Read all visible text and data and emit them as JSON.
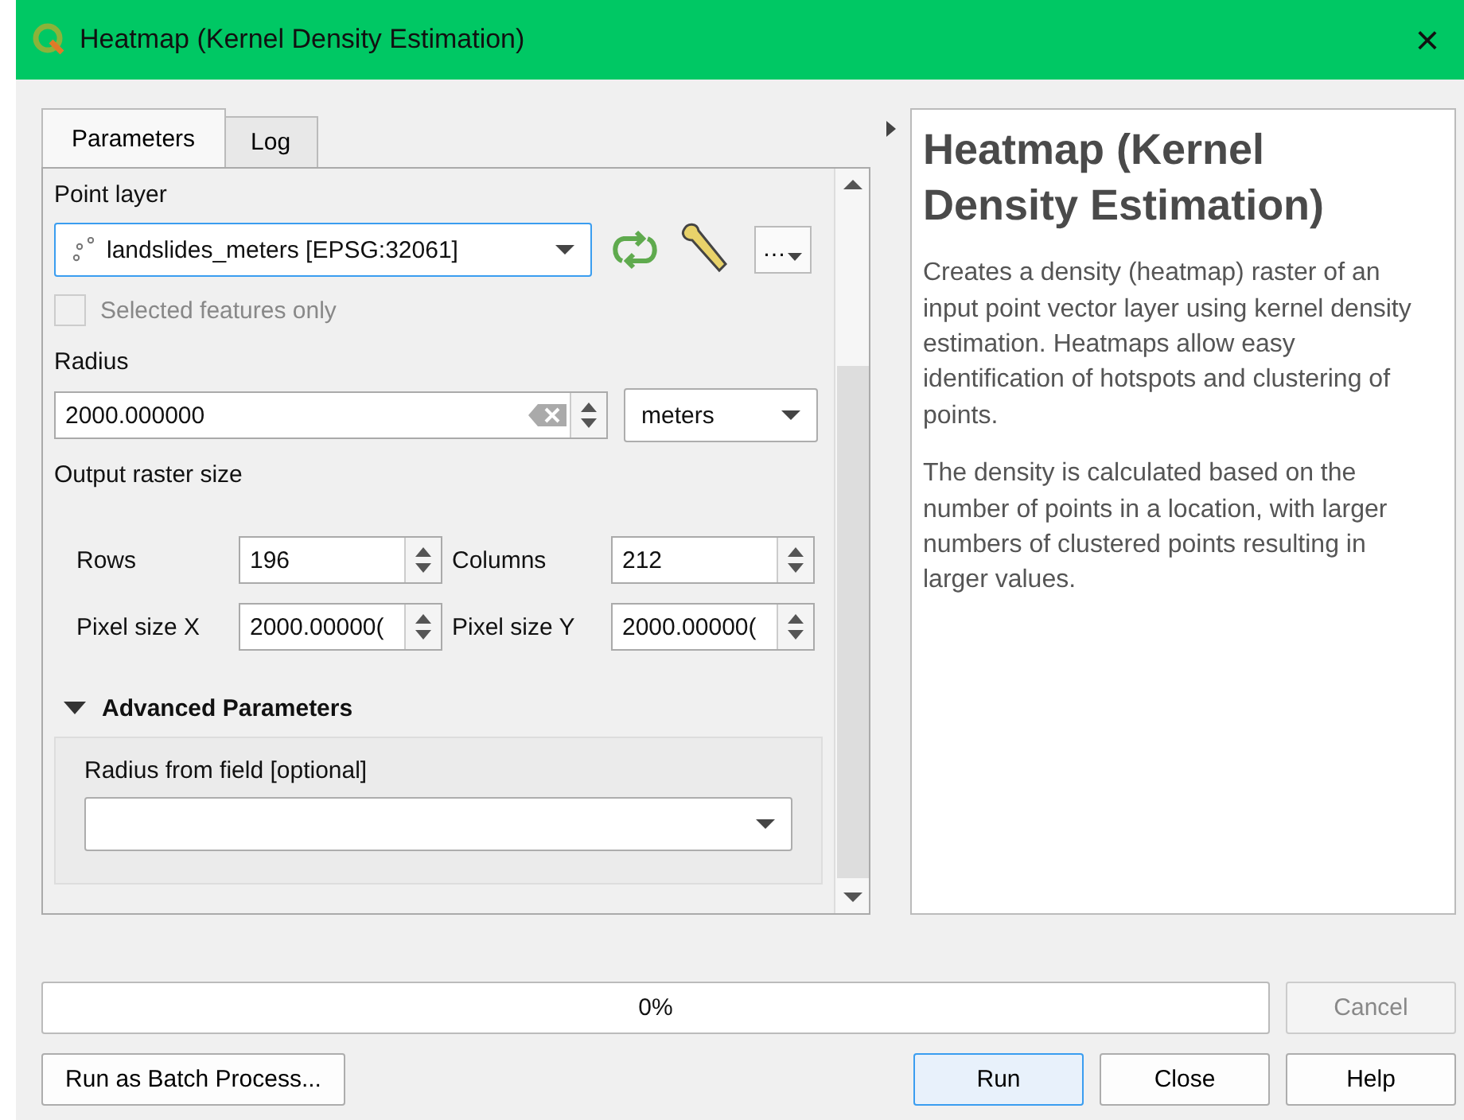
{
  "window": {
    "title": "Heatmap (Kernel Density Estimation)",
    "close": "×"
  },
  "tabs": [
    {
      "label": "Parameters",
      "selected": true
    },
    {
      "label": "Log",
      "selected": false
    }
  ],
  "parameters": {
    "point_layer": {
      "label": "Point layer",
      "value": "landslides_meters [EPSG:32061]",
      "more": "…"
    },
    "selected_features": {
      "label": "Selected features only",
      "checked": false,
      "disabled": true
    },
    "radius": {
      "label": "Radius",
      "value": "2000.000000",
      "unit": "meters"
    },
    "output_raster_size": {
      "label": "Output raster size",
      "fields": [
        {
          "label": "Rows",
          "value": "196"
        },
        {
          "label": "Columns",
          "value": "212"
        },
        {
          "label": "Pixel size X",
          "value": "2000.00000("
        },
        {
          "label": "Pixel size Y",
          "value": "2000.00000("
        }
      ]
    },
    "advanced": {
      "label": "Advanced Parameters",
      "expanded": true,
      "radius_from_field": {
        "label": "Radius from field [optional]"
      }
    }
  },
  "help": {
    "title": "Heatmap (Kernel Density Estimation)",
    "paragraphs": [
      "Creates a density (heatmap) raster of an input point vector layer using kernel density estimation. Heatmaps allow easy identification of hotspots and clustering of points.",
      "The density is calculated based on the number of points in a location, with larger numbers of clustered points resulting in larger values."
    ]
  },
  "progress": {
    "label": "0%"
  },
  "buttons": {
    "cancel": {
      "label": "Cancel",
      "disabled": true
    },
    "batch": {
      "label": "Run as Batch Process..."
    },
    "run": {
      "label": "Run"
    },
    "close": {
      "label": "Close"
    },
    "help": {
      "label": "Help"
    }
  }
}
